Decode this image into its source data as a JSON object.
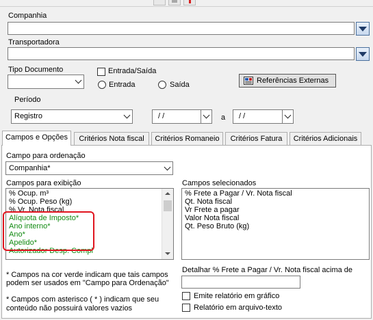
{
  "companhia": {
    "label": "Companhia",
    "value": ""
  },
  "transportadora": {
    "label": "Transportadora",
    "value": ""
  },
  "tipo_documento": {
    "label": "Tipo Documento",
    "value": ""
  },
  "entrada_saida": {
    "label": "Entrada/Saída",
    "checked": false,
    "entrada_label": "Entrada",
    "saida_label": "Saída"
  },
  "referencias_button": "Referências Externas",
  "periodo": {
    "label": "Período",
    "tipo": "Registro",
    "de": "/ /",
    "separator": "a",
    "ate": "/ /"
  },
  "tabs": [
    {
      "label": "Campos e Opções",
      "active": true
    },
    {
      "label": "Critérios Nota fiscal"
    },
    {
      "label": "Critérios Romaneio"
    },
    {
      "label": "Critérios Fatura"
    },
    {
      "label": "Critérios Adicionais"
    }
  ],
  "ordenacao": {
    "label": "Campo para ordenação",
    "value": "Companhia*"
  },
  "campos_exibicao": {
    "label": "Campos para exibição",
    "items": [
      {
        "text": "% Ocup. m³",
        "green": false
      },
      {
        "text": "% Ocup. Peso (kg)",
        "green": false
      },
      {
        "text": "% Vr. Nota fiscal",
        "green": false
      },
      {
        "text": "Alíquota de Imposto*",
        "green": true
      },
      {
        "text": "Ano interno*",
        "green": true
      },
      {
        "text": "Ano*",
        "green": true
      },
      {
        "text": "Apelido*",
        "green": true
      },
      {
        "text": "Autorizador Desp. Compl",
        "green": true
      }
    ]
  },
  "campos_selecionados": {
    "label": "Campos selecionados",
    "items": [
      "% Frete a Pagar / Vr. Nota fiscal",
      "Qt. Nota fiscal",
      "Vr Frete a pagar",
      "Valor Nota fiscal",
      "Qt. Peso Bruto (kg)"
    ]
  },
  "note_green_1": "* Campos na cor verde indicam que tais campos",
  "note_green_2": "podem ser usados em \"Campo para Ordenação\"",
  "note_asterisk_1": "* Campos com asterisco ( * ) indicam que seu",
  "note_asterisk_2": "conteúdo não possuirá valores vazios",
  "detalhar": {
    "label": "Detalhar % Frete a Pagar / Vr. Nota fiscal acima de",
    "value": ""
  },
  "emite_grafico": {
    "label": "Emite relatório em gráfico",
    "checked": false
  },
  "relatorio_texto": {
    "label": "Relatório em arquivo-texto",
    "checked": false
  },
  "colors": {
    "highlight": "#e0141e",
    "green_text": "#118a11",
    "dropdown_accent": "#1e3a66"
  }
}
